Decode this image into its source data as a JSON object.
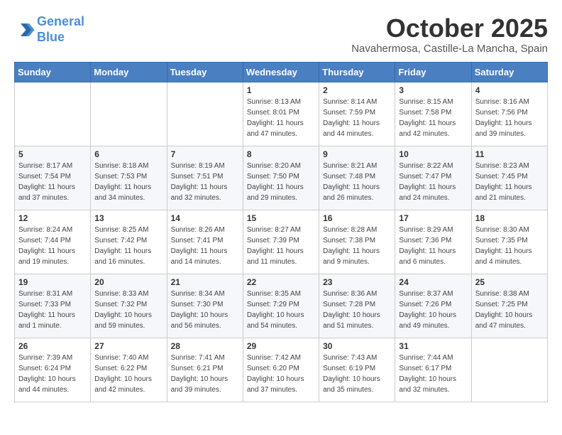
{
  "header": {
    "logo_line1": "General",
    "logo_line2": "Blue",
    "month": "October 2025",
    "location": "Navahermosa, Castille-La Mancha, Spain"
  },
  "weekdays": [
    "Sunday",
    "Monday",
    "Tuesday",
    "Wednesday",
    "Thursday",
    "Friday",
    "Saturday"
  ],
  "weeks": [
    [
      {
        "day": "",
        "sunrise": "",
        "sunset": "",
        "daylight": ""
      },
      {
        "day": "",
        "sunrise": "",
        "sunset": "",
        "daylight": ""
      },
      {
        "day": "",
        "sunrise": "",
        "sunset": "",
        "daylight": ""
      },
      {
        "day": "1",
        "sunrise": "Sunrise: 8:13 AM",
        "sunset": "Sunset: 8:01 PM",
        "daylight": "Daylight: 11 hours and 47 minutes."
      },
      {
        "day": "2",
        "sunrise": "Sunrise: 8:14 AM",
        "sunset": "Sunset: 7:59 PM",
        "daylight": "Daylight: 11 hours and 44 minutes."
      },
      {
        "day": "3",
        "sunrise": "Sunrise: 8:15 AM",
        "sunset": "Sunset: 7:58 PM",
        "daylight": "Daylight: 11 hours and 42 minutes."
      },
      {
        "day": "4",
        "sunrise": "Sunrise: 8:16 AM",
        "sunset": "Sunset: 7:56 PM",
        "daylight": "Daylight: 11 hours and 39 minutes."
      }
    ],
    [
      {
        "day": "5",
        "sunrise": "Sunrise: 8:17 AM",
        "sunset": "Sunset: 7:54 PM",
        "daylight": "Daylight: 11 hours and 37 minutes."
      },
      {
        "day": "6",
        "sunrise": "Sunrise: 8:18 AM",
        "sunset": "Sunset: 7:53 PM",
        "daylight": "Daylight: 11 hours and 34 minutes."
      },
      {
        "day": "7",
        "sunrise": "Sunrise: 8:19 AM",
        "sunset": "Sunset: 7:51 PM",
        "daylight": "Daylight: 11 hours and 32 minutes."
      },
      {
        "day": "8",
        "sunrise": "Sunrise: 8:20 AM",
        "sunset": "Sunset: 7:50 PM",
        "daylight": "Daylight: 11 hours and 29 minutes."
      },
      {
        "day": "9",
        "sunrise": "Sunrise: 8:21 AM",
        "sunset": "Sunset: 7:48 PM",
        "daylight": "Daylight: 11 hours and 26 minutes."
      },
      {
        "day": "10",
        "sunrise": "Sunrise: 8:22 AM",
        "sunset": "Sunset: 7:47 PM",
        "daylight": "Daylight: 11 hours and 24 minutes."
      },
      {
        "day": "11",
        "sunrise": "Sunrise: 8:23 AM",
        "sunset": "Sunset: 7:45 PM",
        "daylight": "Daylight: 11 hours and 21 minutes."
      }
    ],
    [
      {
        "day": "12",
        "sunrise": "Sunrise: 8:24 AM",
        "sunset": "Sunset: 7:44 PM",
        "daylight": "Daylight: 11 hours and 19 minutes."
      },
      {
        "day": "13",
        "sunrise": "Sunrise: 8:25 AM",
        "sunset": "Sunset: 7:42 PM",
        "daylight": "Daylight: 11 hours and 16 minutes."
      },
      {
        "day": "14",
        "sunrise": "Sunrise: 8:26 AM",
        "sunset": "Sunset: 7:41 PM",
        "daylight": "Daylight: 11 hours and 14 minutes."
      },
      {
        "day": "15",
        "sunrise": "Sunrise: 8:27 AM",
        "sunset": "Sunset: 7:39 PM",
        "daylight": "Daylight: 11 hours and 11 minutes."
      },
      {
        "day": "16",
        "sunrise": "Sunrise: 8:28 AM",
        "sunset": "Sunset: 7:38 PM",
        "daylight": "Daylight: 11 hours and 9 minutes."
      },
      {
        "day": "17",
        "sunrise": "Sunrise: 8:29 AM",
        "sunset": "Sunset: 7:36 PM",
        "daylight": "Daylight: 11 hours and 6 minutes."
      },
      {
        "day": "18",
        "sunrise": "Sunrise: 8:30 AM",
        "sunset": "Sunset: 7:35 PM",
        "daylight": "Daylight: 11 hours and 4 minutes."
      }
    ],
    [
      {
        "day": "19",
        "sunrise": "Sunrise: 8:31 AM",
        "sunset": "Sunset: 7:33 PM",
        "daylight": "Daylight: 11 hours and 1 minute."
      },
      {
        "day": "20",
        "sunrise": "Sunrise: 8:33 AM",
        "sunset": "Sunset: 7:32 PM",
        "daylight": "Daylight: 10 hours and 59 minutes."
      },
      {
        "day": "21",
        "sunrise": "Sunrise: 8:34 AM",
        "sunset": "Sunset: 7:30 PM",
        "daylight": "Daylight: 10 hours and 56 minutes."
      },
      {
        "day": "22",
        "sunrise": "Sunrise: 8:35 AM",
        "sunset": "Sunset: 7:29 PM",
        "daylight": "Daylight: 10 hours and 54 minutes."
      },
      {
        "day": "23",
        "sunrise": "Sunrise: 8:36 AM",
        "sunset": "Sunset: 7:28 PM",
        "daylight": "Daylight: 10 hours and 51 minutes."
      },
      {
        "day": "24",
        "sunrise": "Sunrise: 8:37 AM",
        "sunset": "Sunset: 7:26 PM",
        "daylight": "Daylight: 10 hours and 49 minutes."
      },
      {
        "day": "25",
        "sunrise": "Sunrise: 8:38 AM",
        "sunset": "Sunset: 7:25 PM",
        "daylight": "Daylight: 10 hours and 47 minutes."
      }
    ],
    [
      {
        "day": "26",
        "sunrise": "Sunrise: 7:39 AM",
        "sunset": "Sunset: 6:24 PM",
        "daylight": "Daylight: 10 hours and 44 minutes."
      },
      {
        "day": "27",
        "sunrise": "Sunrise: 7:40 AM",
        "sunset": "Sunset: 6:22 PM",
        "daylight": "Daylight: 10 hours and 42 minutes."
      },
      {
        "day": "28",
        "sunrise": "Sunrise: 7:41 AM",
        "sunset": "Sunset: 6:21 PM",
        "daylight": "Daylight: 10 hours and 39 minutes."
      },
      {
        "day": "29",
        "sunrise": "Sunrise: 7:42 AM",
        "sunset": "Sunset: 6:20 PM",
        "daylight": "Daylight: 10 hours and 37 minutes."
      },
      {
        "day": "30",
        "sunrise": "Sunrise: 7:43 AM",
        "sunset": "Sunset: 6:19 PM",
        "daylight": "Daylight: 10 hours and 35 minutes."
      },
      {
        "day": "31",
        "sunrise": "Sunrise: 7:44 AM",
        "sunset": "Sunset: 6:17 PM",
        "daylight": "Daylight: 10 hours and 32 minutes."
      },
      {
        "day": "",
        "sunrise": "",
        "sunset": "",
        "daylight": ""
      }
    ]
  ]
}
